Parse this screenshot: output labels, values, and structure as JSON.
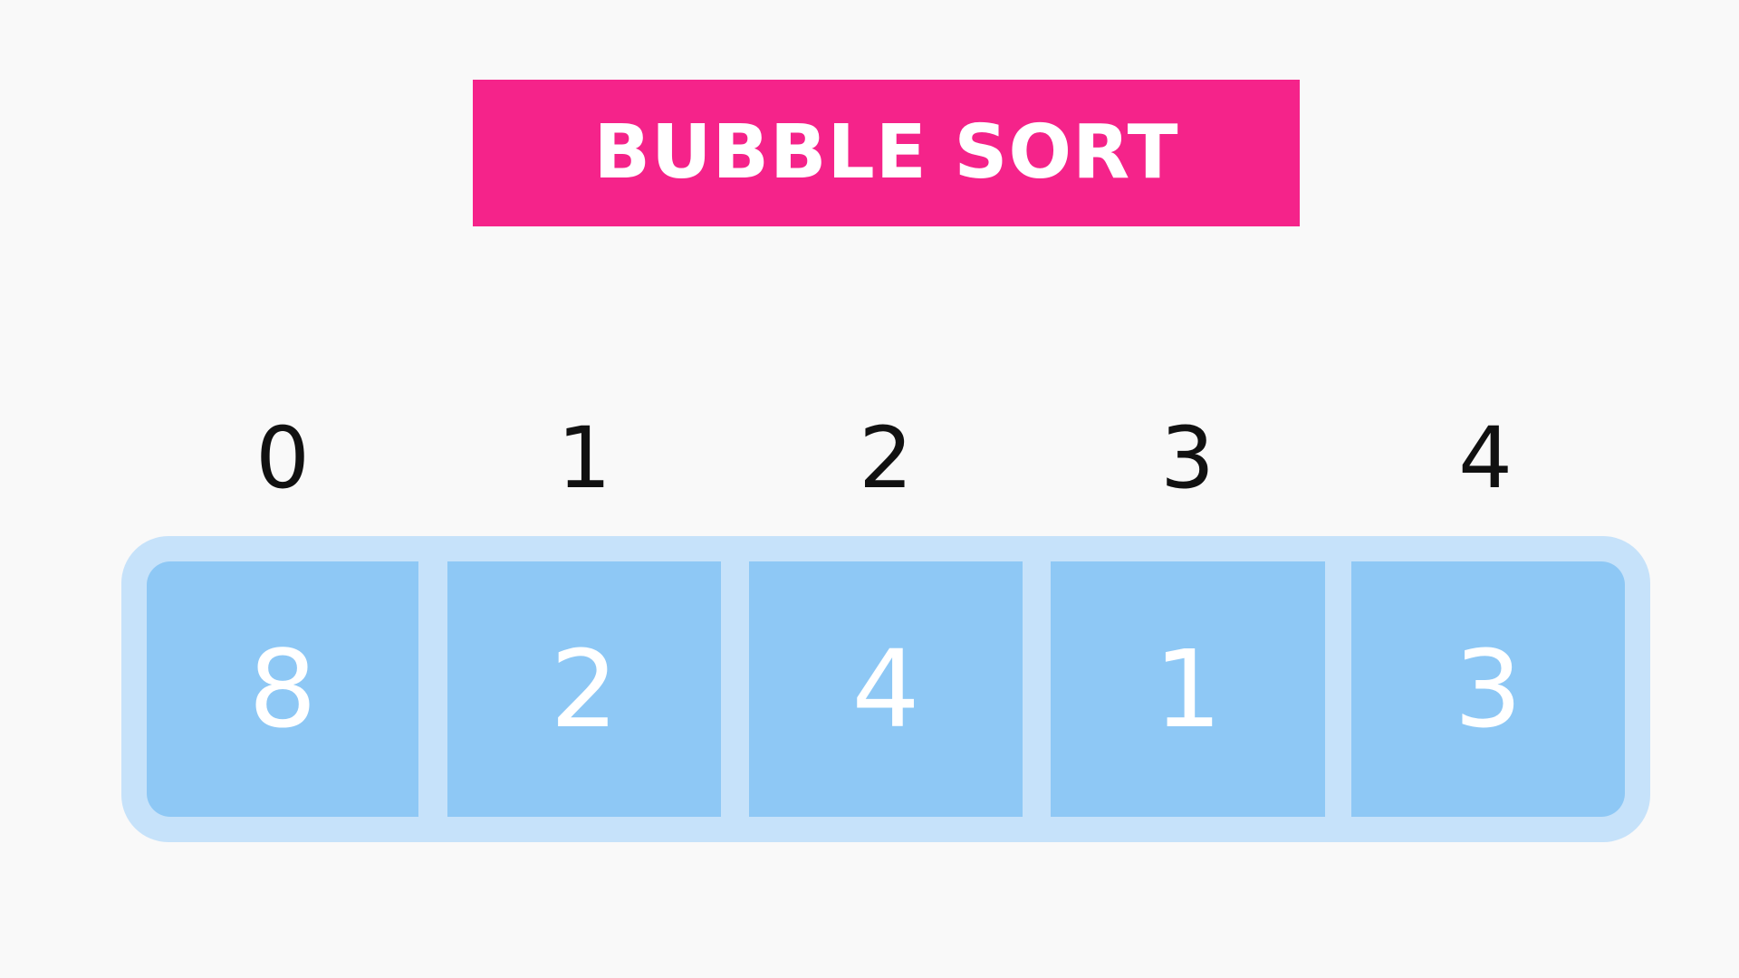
{
  "title": {
    "text": "BUBBLE SORT"
  },
  "array": {
    "indices": [
      "0",
      "1",
      "2",
      "3",
      "4"
    ],
    "values": [
      "8",
      "2",
      "4",
      "1",
      "3"
    ]
  },
  "colors": {
    "background": "#f9f9f9",
    "title_bg": "#f5238a",
    "title_text": "#ffffff",
    "container": "#c6e2fa",
    "cell": "#8ec8f5",
    "cell_text": "#ffffff",
    "index_text": "#111111"
  }
}
